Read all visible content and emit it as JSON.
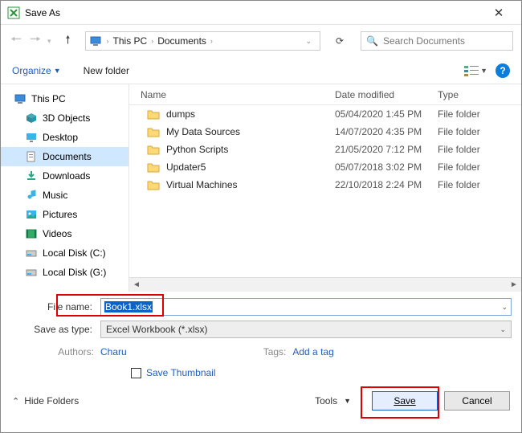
{
  "title": "Save As",
  "breadcrumb": {
    "root": "This PC",
    "folder": "Documents"
  },
  "search": {
    "placeholder": "Search Documents"
  },
  "toolbar": {
    "organize": "Organize",
    "newfolder": "New folder"
  },
  "sidebar": {
    "root": "This PC",
    "items": [
      "3D Objects",
      "Desktop",
      "Documents",
      "Downloads",
      "Music",
      "Pictures",
      "Videos",
      "Local Disk (C:)",
      "Local Disk (G:)"
    ]
  },
  "columns": {
    "name": "Name",
    "date": "Date modified",
    "type": "Type"
  },
  "files": [
    {
      "name": "dumps",
      "date": "05/04/2020 1:45 PM",
      "type": "File folder"
    },
    {
      "name": "My Data Sources",
      "date": "14/07/2020 4:35 PM",
      "type": "File folder"
    },
    {
      "name": "Python Scripts",
      "date": "21/05/2020 7:12 PM",
      "type": "File folder"
    },
    {
      "name": "Updater5",
      "date": "05/07/2018 3:02 PM",
      "type": "File folder"
    },
    {
      "name": "Virtual Machines",
      "date": "22/10/2018 2:24 PM",
      "type": "File folder"
    }
  ],
  "filename": {
    "label": "File name:",
    "value": "Book1.xlsx"
  },
  "savetype": {
    "label": "Save as type:",
    "value": "Excel Workbook (*.xlsx)"
  },
  "meta": {
    "authors_lbl": "Authors:",
    "authors_val": "Charu",
    "tags_lbl": "Tags:",
    "tags_val": "Add a tag"
  },
  "thumb": "Save Thumbnail",
  "footer": {
    "hide": "Hide Folders",
    "tools": "Tools",
    "save": "Save",
    "cancel": "Cancel"
  }
}
